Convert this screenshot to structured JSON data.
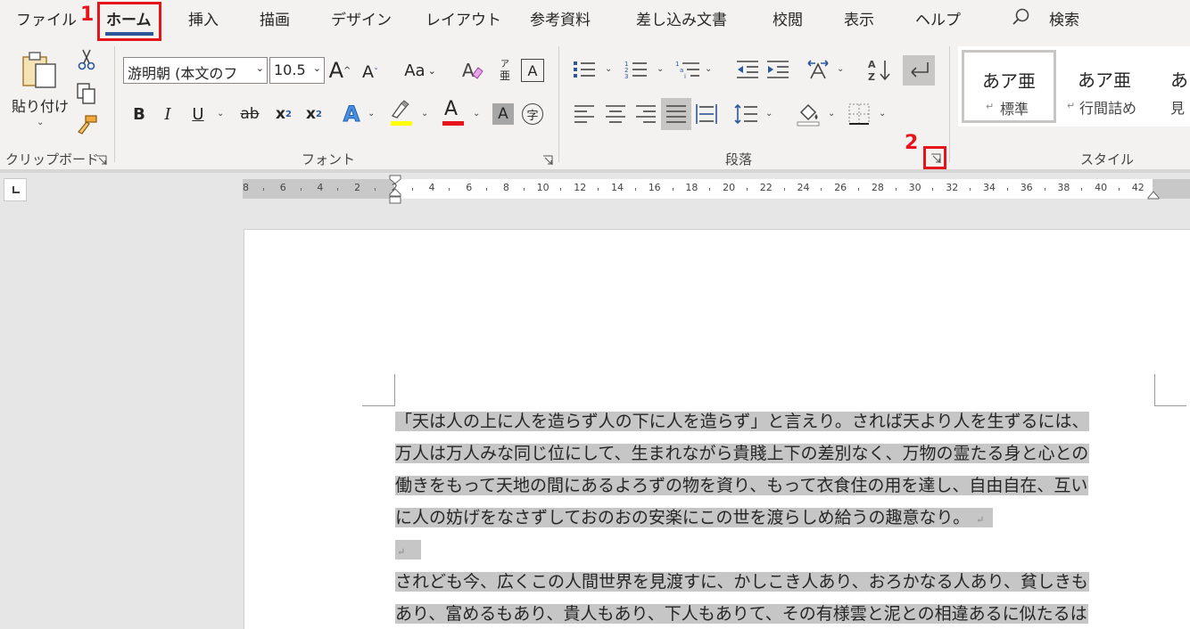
{
  "tabs": [
    "ファイル",
    "ホーム",
    "挿入",
    "描画",
    "デザイン",
    "レイアウト",
    "参考資料",
    "差し込み文書",
    "校閲",
    "表示",
    "ヘルプ"
  ],
  "search_label": "検索",
  "clipboard": {
    "paste_label": "貼り付け",
    "group_label": "クリップボード"
  },
  "font": {
    "name": "游明朝 (本文のフ",
    "size": "10.5",
    "case_label": "Aa",
    "group_label": "フォント"
  },
  "paragraph": {
    "group_label": "段落"
  },
  "styles": {
    "group_label": "スタイル",
    "sample": "あア亜",
    "items": [
      "標準",
      "行間詰め",
      "見"
    ]
  },
  "ruler": {
    "numbers": [
      "8",
      "6",
      "4",
      "2",
      "2",
      "4",
      "6",
      "8",
      "10",
      "12",
      "14",
      "16",
      "18",
      "20",
      "22",
      "24",
      "26",
      "28",
      "30",
      "32",
      "34",
      "36",
      "38",
      "40",
      "42"
    ]
  },
  "document": {
    "lines": [
      "「天は人の上に人を造らず人の下に人を造らず」と言えり。されば天より人を生ずるには、",
      "万人は万人みな同じ位にして、生まれながら貴賤上下の差別なく、万物の霊たる身と心との",
      "働きをもって天地の間にあるよろずの物を資り、もって衣食住の用を達し、自由自在、互い",
      "に人の妨げをなさずしておのおの安楽にこの世を渡らしめ給うの趣意なり。",
      "",
      "されども今、広くこの人間世界を見渡すに、かしこき人あり、おろかなる人あり、貧しきも",
      "あり、富めるもあり、貴人もあり、下人もありて、その有様雲と泥との相違あるに似たるは"
    ],
    "pilcrow": "↵"
  },
  "annotations": {
    "step1": "1",
    "step2": "2"
  },
  "colors": {
    "accent": "#2b579a",
    "annotation": "#e8141b",
    "highlight": "#c6c6c6"
  }
}
